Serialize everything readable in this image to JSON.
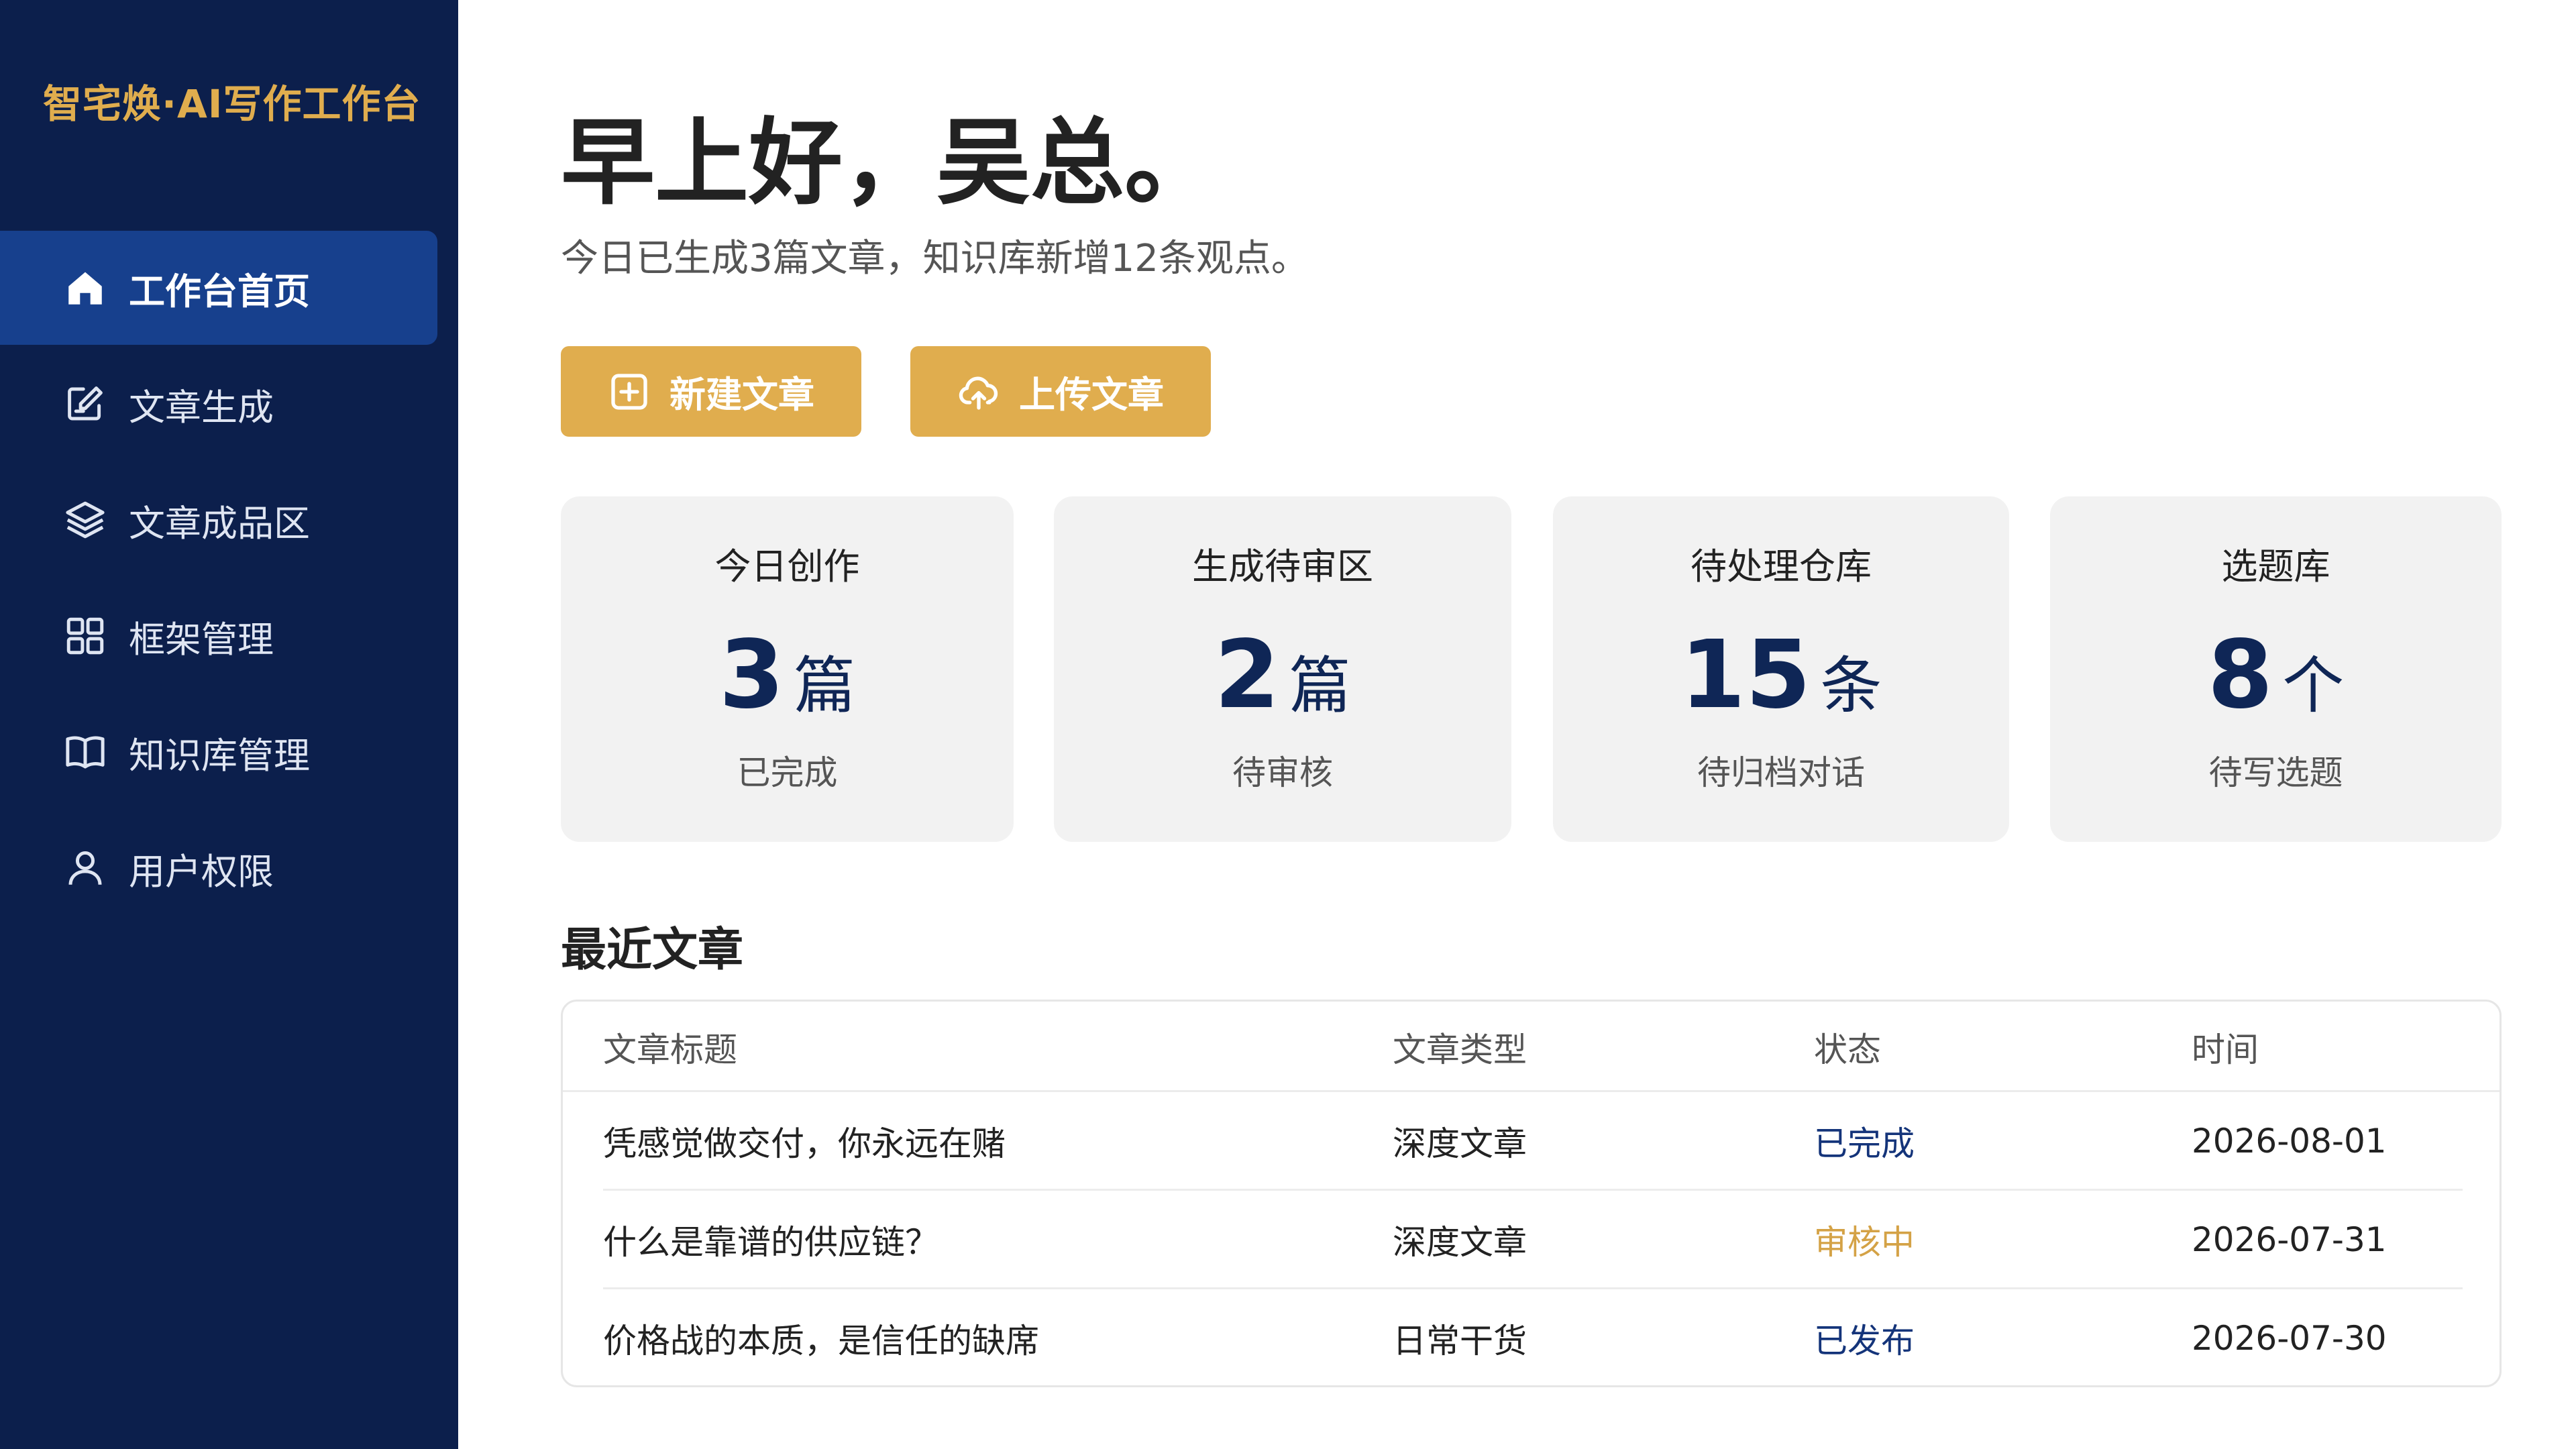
{
  "sidebar": {
    "brand": "智宅焕·AI写作工作台",
    "items": [
      {
        "label": "工作台首页",
        "icon": "home-icon"
      },
      {
        "label": "文章生成",
        "icon": "edit-icon"
      },
      {
        "label": "文章成品区",
        "icon": "layers-icon"
      },
      {
        "label": "框架管理",
        "icon": "grid-icon"
      },
      {
        "label": "知识库管理",
        "icon": "book-icon"
      },
      {
        "label": "用户权限",
        "icon": "user-icon"
      }
    ]
  },
  "header": {
    "greeting": "早上好，吴总。",
    "subtitle": "今日已生成3篇文章，知识库新增12条观点。"
  },
  "actions": {
    "new_article": "新建文章",
    "upload_article": "上传文章"
  },
  "stats": [
    {
      "title": "今日创作",
      "value": "3",
      "unit": "篇",
      "desc": "已完成"
    },
    {
      "title": "生成待审区",
      "value": "2",
      "unit": "篇",
      "desc": "待审核"
    },
    {
      "title": "待处理仓库",
      "value": "15",
      "unit": "条",
      "desc": "待归档对话"
    },
    {
      "title": "选题库",
      "value": "8",
      "unit": "个",
      "desc": "待写选题"
    }
  ],
  "recent": {
    "title": "最近文章",
    "columns": [
      "文章标题",
      "文章类型",
      "状态",
      "时间"
    ],
    "rows": [
      {
        "title": "凭感觉做交付，你永远在赌",
        "type": "深度文章",
        "status": "已完成",
        "date": "2026-08-01"
      },
      {
        "title": "什么是靠谱的供应链？",
        "type": "深度文章",
        "status": "审核中",
        "date": "2026-07-31"
      },
      {
        "title": "价格战的本质，是信任的缺席",
        "type": "日常干货",
        "status": "已发布",
        "date": "2026-07-30"
      }
    ]
  },
  "colors": {
    "sidebar_bg": "#0c1f4c",
    "active_bg": "#17408d",
    "accent_gold": "#e0ad4e",
    "number_navy": "#0f2656",
    "status_blue": "#14347a",
    "status_orange": "#d4a246"
  }
}
